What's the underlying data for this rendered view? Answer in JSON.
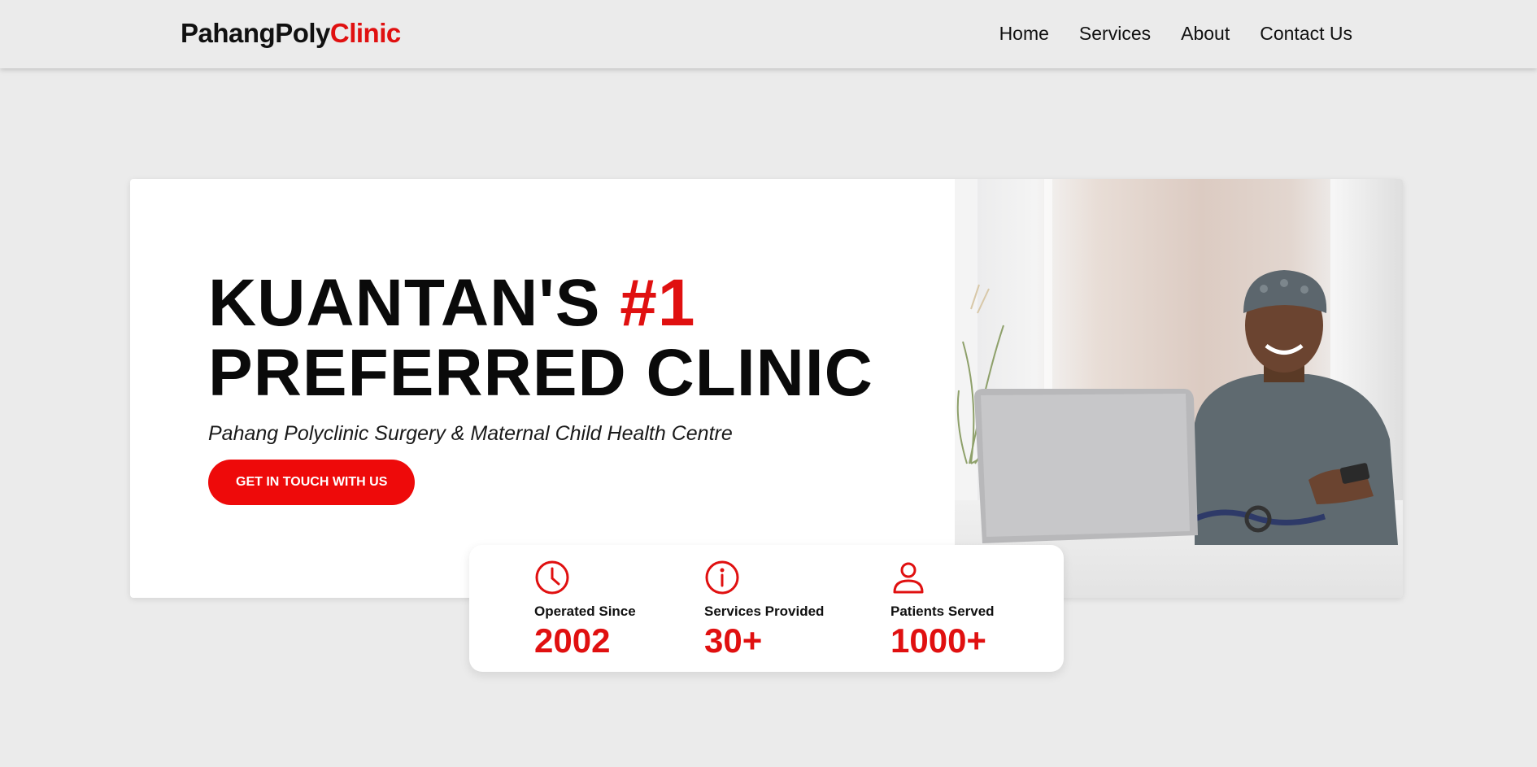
{
  "brand": {
    "name_primary": "PahangPoly",
    "name_accent": "Clinic"
  },
  "nav": {
    "items": [
      {
        "label": "Home"
      },
      {
        "label": "Services"
      },
      {
        "label": "About"
      },
      {
        "label": "Contact Us"
      }
    ]
  },
  "hero": {
    "title_line1_prefix": "KUANTAN'S ",
    "title_line1_highlight": "#1",
    "title_line2": "PREFERRED CLINIC",
    "subtitle": "Pahang Polyclinic Surgery & Maternal Child Health Centre",
    "cta_label": "GET IN TOUCH WITH US",
    "photo_description_icon": "doctor-with-laptop-photo"
  },
  "stats": [
    {
      "icon": "clock-icon",
      "label": "Operated Since",
      "value": "2002"
    },
    {
      "icon": "info-icon",
      "label": "Services Provided",
      "value": "30+"
    },
    {
      "icon": "user-icon",
      "label": "Patients Served",
      "value": "1000+"
    }
  ],
  "colors": {
    "accent": "#e01010",
    "background": "#ebebeb",
    "text": "#111111"
  }
}
